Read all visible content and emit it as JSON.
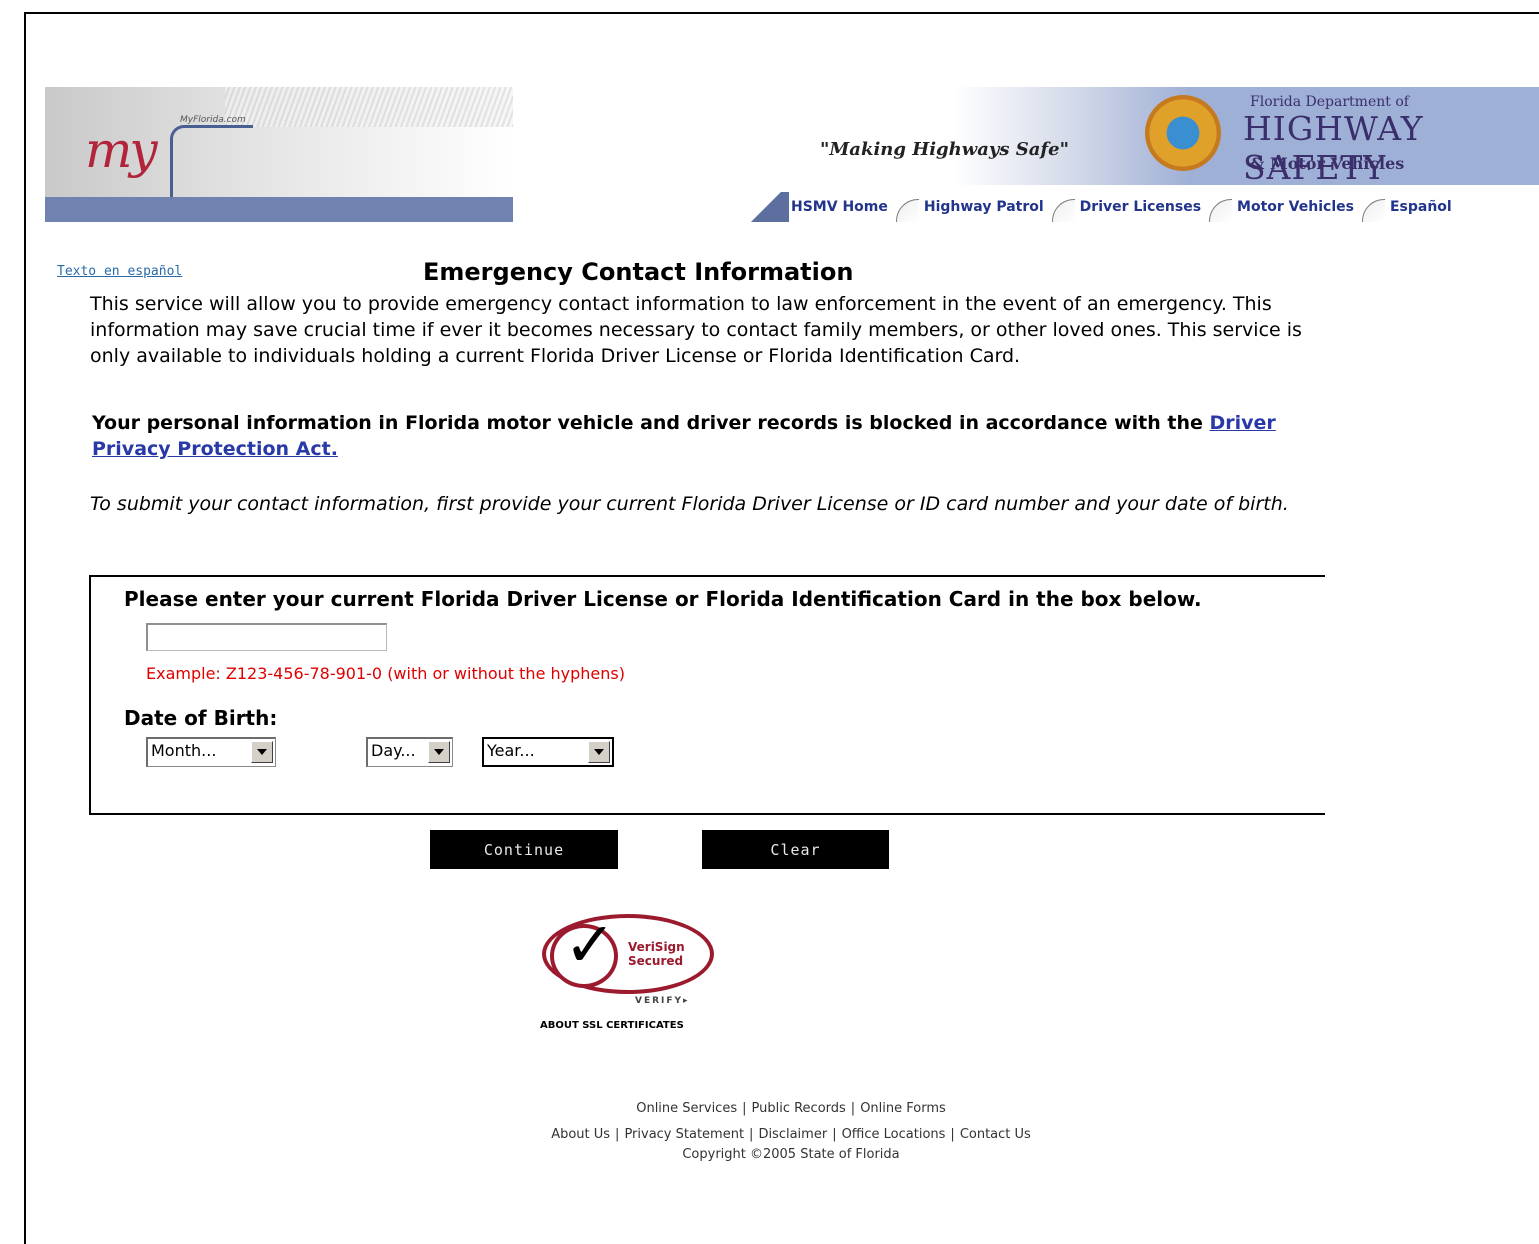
{
  "header": {
    "myflorida_small": "MyFlorida.com",
    "my_logo": "my",
    "slogan": "\"Making Highways Safe\"",
    "dept_line1": "Florida Department of",
    "dept_line2": "HIGHWAY SAFETY",
    "dept_line3": "& Motor Vehicles"
  },
  "nav": {
    "items": [
      {
        "label": "HSMV Home"
      },
      {
        "label": "Highway Patrol"
      },
      {
        "label": "Driver Licenses"
      },
      {
        "label": "Motor Vehicles"
      },
      {
        "label": "Español"
      }
    ]
  },
  "page": {
    "espanol_link": "Texto en español",
    "title": "Emergency Contact Information",
    "intro": "This service will allow you to provide emergency contact information to law enforcement in the event of an emergency. This information may save crucial time if ever it becomes necessary to contact family members, or other loved ones. This service is only available to individuals holding a current Florida Driver License or Florida Identification Card.",
    "privacy_text": "Your personal information in Florida motor vehicle and driver records is blocked in accordance with the ",
    "privacy_link": "Driver Privacy Protection Act.",
    "instructions": "To submit your contact information, first provide your current Florida Driver License or ID card number and your date of birth."
  },
  "form": {
    "heading": "Please enter your current Florida Driver License or Florida Identification Card in the box below.",
    "license_value": "",
    "example": "Example: Z123-456-78-901-0 (with or without the hyphens)",
    "dob_label": "Date of Birth:",
    "month": "Month...",
    "day": "Day...",
    "year": "Year...",
    "continue_label": "Continue",
    "clear_label": "Clear"
  },
  "verisign": {
    "line1": "VeriSign",
    "line2": "Secured",
    "verify": "VERIFY▸",
    "about_ssl": "ABOUT SSL CERTIFICATES"
  },
  "footer": {
    "row1": [
      "Online Services",
      "Public Records",
      "Online Forms"
    ],
    "row2": [
      "About Us",
      "Privacy Statement",
      "Disclaimer",
      "Office Locations",
      "Contact Us"
    ],
    "copyright": "Copyright ©2005 State of Florida"
  },
  "colors": {
    "nav_link": "#22348b",
    "example_text": "#e00000",
    "privacy_link": "#2a39a8",
    "verisign_red": "#9b1a2e"
  }
}
